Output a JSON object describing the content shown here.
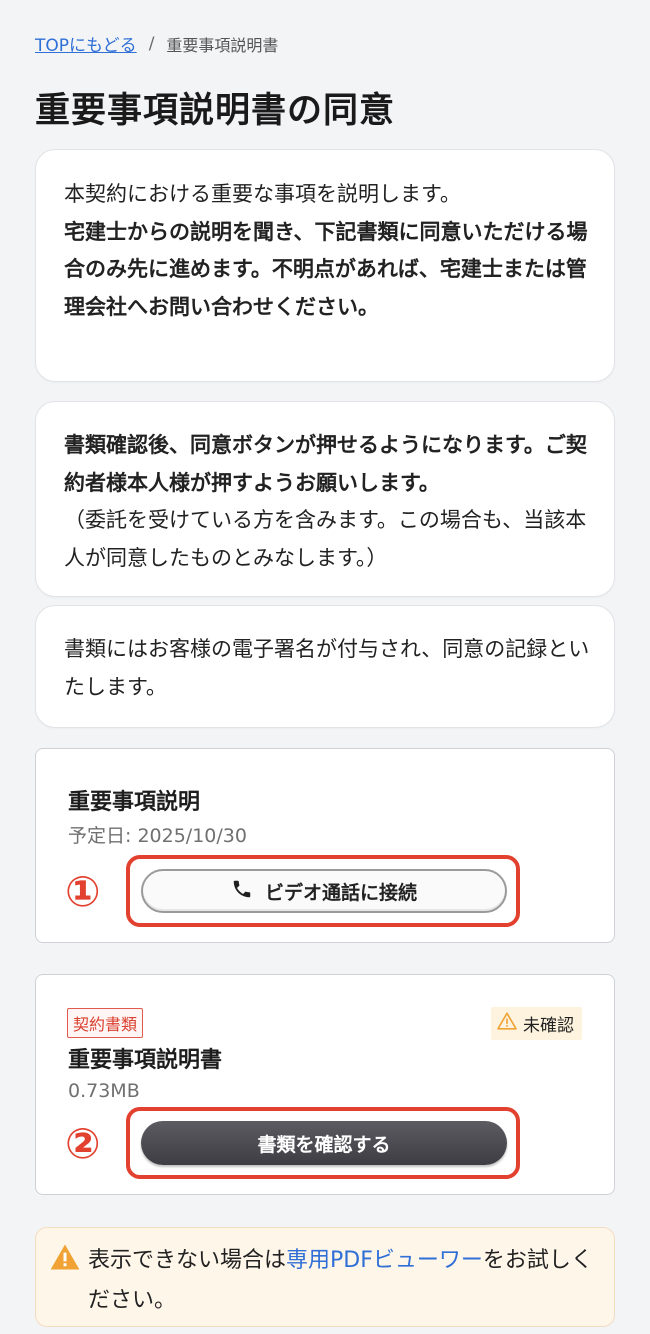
{
  "breadcrumb": {
    "top_link": "TOPにもどる",
    "separator": "/",
    "current": "重要事項説明書"
  },
  "page_title": "重要事項説明書の同意",
  "info_cards": [
    {
      "normal": "本契約における重要な事項を説明します。",
      "bold": "宅建士からの説明を聞き、下記書類に同意いただける場合のみ先に進めます。不明点があれば、宅建士または管理会社へお問い合わせください。"
    },
    {
      "bold": "書類確認後、同意ボタンが押せるようになります。ご契約者様本人様が押すようお願いします。",
      "normal": "（委託を受けている方を含みます。この場合も、当該本人が同意したものとみなします。）"
    },
    {
      "normal": "書類にはお客様の電子署名が付与され、同意の記録といたします。"
    }
  ],
  "explanation_panel": {
    "title": "重要事項説明",
    "scheduled": "予定日: 2025/10/30",
    "marker": "①",
    "button_label": "ビデオ通話に接続",
    "button_icon": "phone-icon"
  },
  "document_panel": {
    "tag": "契約書類",
    "status": "未確認",
    "status_icon": "warning-icon",
    "title": "重要事項説明書",
    "size": "0.73MB",
    "marker": "②",
    "button_label": "書類を確認する"
  },
  "pdf_notice": {
    "before": "表示できない場合は",
    "link": "専用PDFビューワー",
    "after": "をお試しください。"
  },
  "colors": {
    "accent_red": "#e2412f",
    "link_blue": "#2f6fd6",
    "warning_orange": "#f0a234",
    "dark_button": "#4a4850"
  }
}
